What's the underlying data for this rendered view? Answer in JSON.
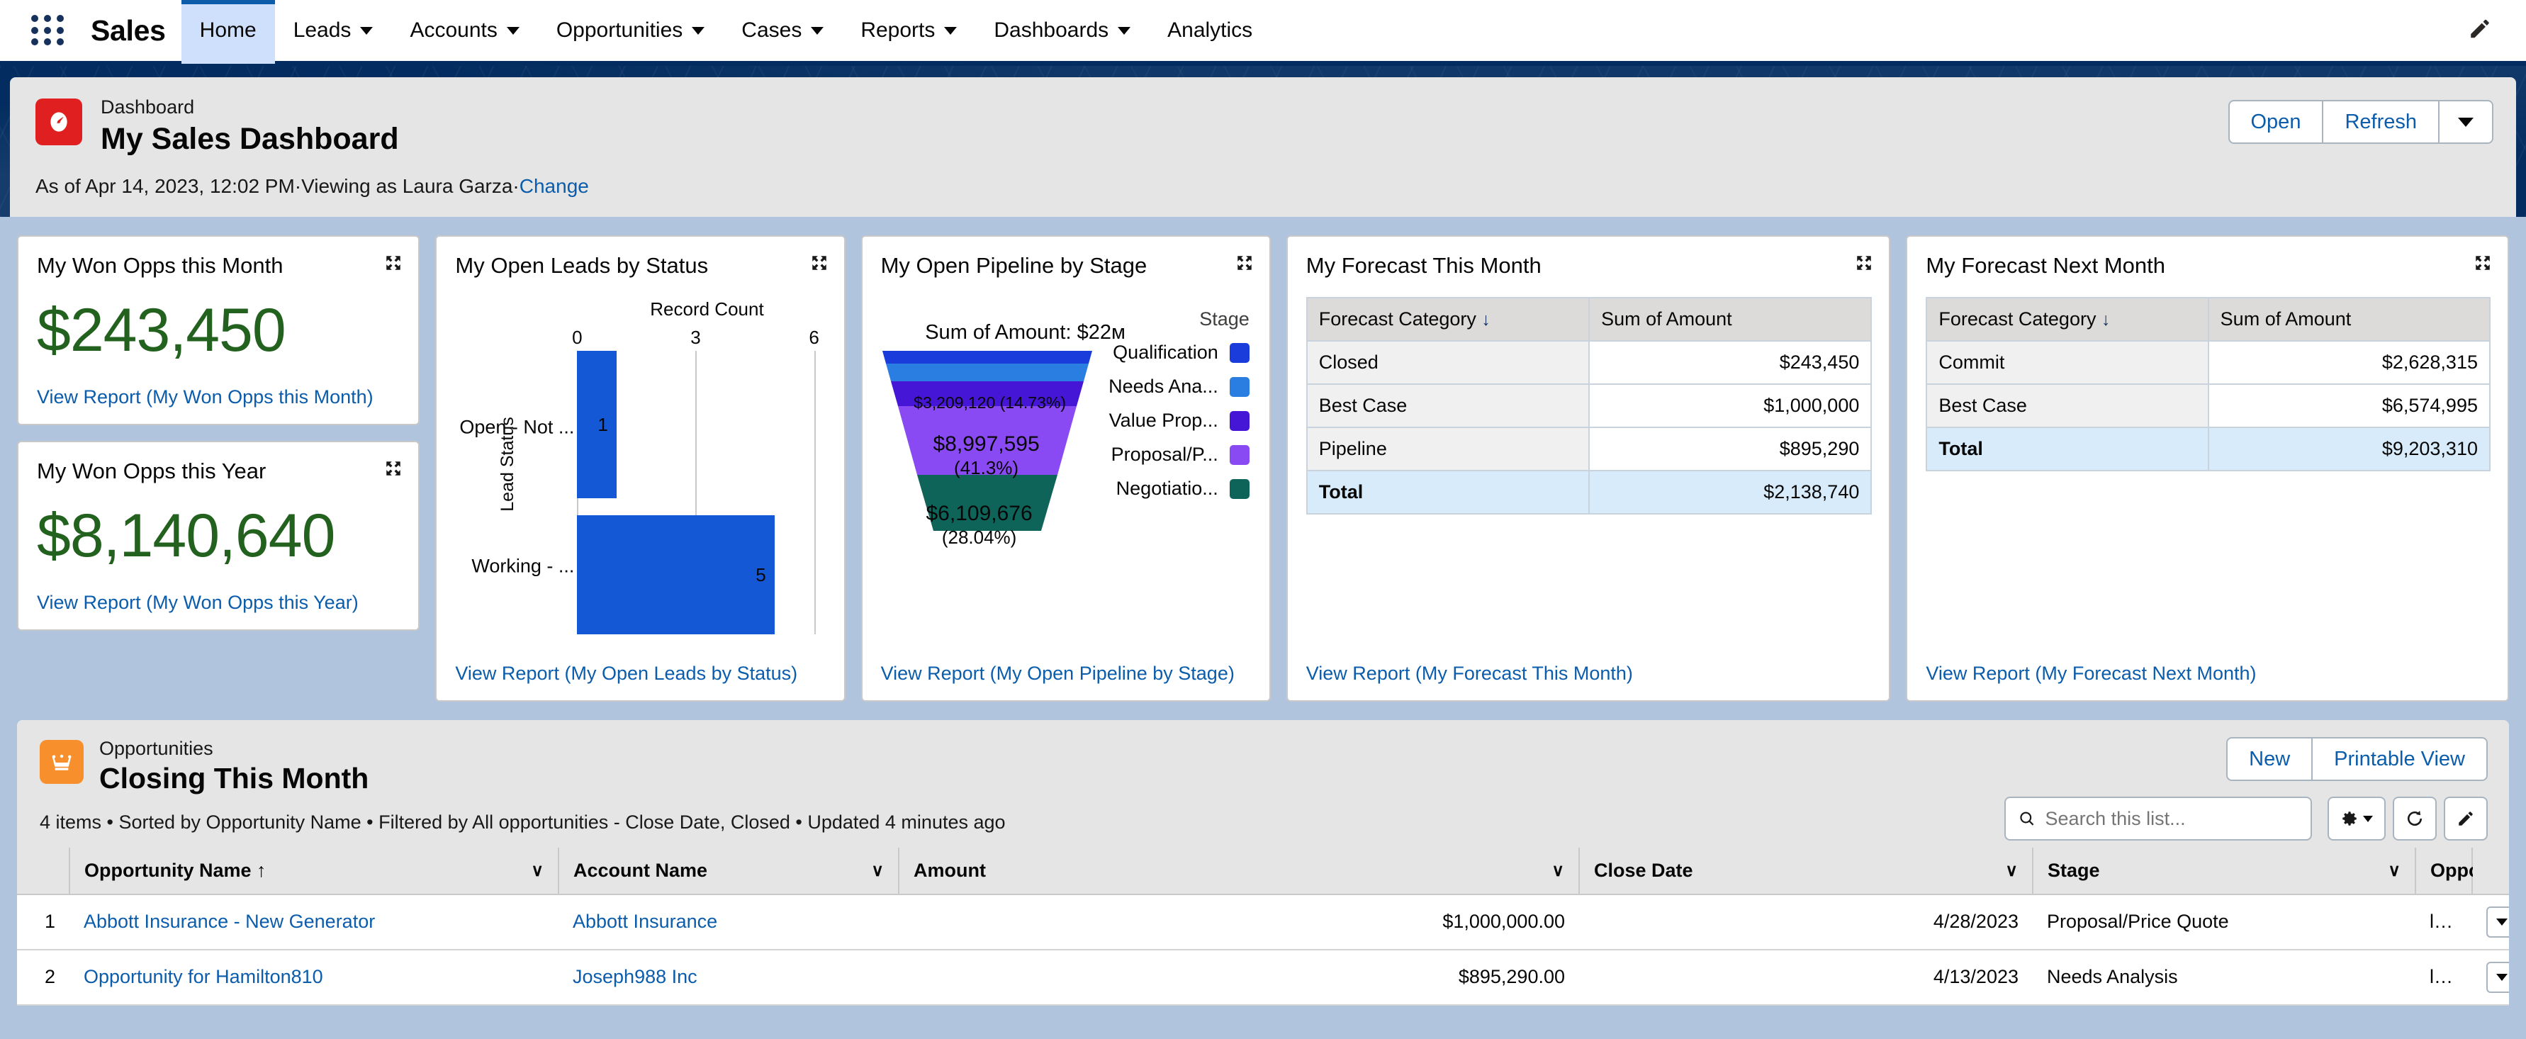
{
  "nav": {
    "app_name": "Sales",
    "items": [
      {
        "label": "Home",
        "has_caret": false,
        "active": true
      },
      {
        "label": "Leads",
        "has_caret": true,
        "active": false
      },
      {
        "label": "Accounts",
        "has_caret": true,
        "active": false
      },
      {
        "label": "Opportunities",
        "has_caret": true,
        "active": false
      },
      {
        "label": "Cases",
        "has_caret": true,
        "active": false
      },
      {
        "label": "Reports",
        "has_caret": true,
        "active": false
      },
      {
        "label": "Dashboards",
        "has_caret": true,
        "active": false
      },
      {
        "label": "Analytics",
        "has_caret": false,
        "active": false
      }
    ],
    "edit_icon": "pencil-icon"
  },
  "dashboard": {
    "eyebrow": "Dashboard",
    "title": "My Sales Dashboard",
    "subtitle_prefix": "As of Apr 14, 2023, 12:02 PM·Viewing as Laura Garza·",
    "change_link": "Change",
    "open_label": "Open",
    "refresh_label": "Refresh",
    "icon": "speedometer-icon",
    "icon_color": "#e02020"
  },
  "widgets": {
    "won_month": {
      "title": "My Won Opps this Month",
      "value": "$243,450",
      "link": "View Report (My Won Opps this Month)",
      "color": "#23611f"
    },
    "won_year": {
      "title": "My Won Opps this Year",
      "value": "$8,140,640",
      "link": "View Report (My Won Opps this Year)",
      "color": "#23611f"
    },
    "open_leads": {
      "title": "My Open Leads by Status",
      "link": "View Report (My Open Leads by Status)"
    },
    "pipeline": {
      "title": "My Open Pipeline by Stage",
      "link": "View Report (My Open Pipeline by Stage)"
    },
    "forecast_this": {
      "title": "My Forecast This Month",
      "link": "View Report (My Forecast This Month)"
    },
    "forecast_next": {
      "title": "My Forecast Next Month",
      "link": "View Report (My Forecast Next Month)"
    }
  },
  "chart_data": [
    {
      "type": "bar",
      "title": "My Open Leads by Status",
      "orientation": "horizontal",
      "categories": [
        "Open - Not ...",
        "Working - ..."
      ],
      "values": [
        1,
        5
      ],
      "xlabel": "Record Count",
      "ylabel": "Lead Status",
      "xlim": [
        0,
        6
      ],
      "xticks": [
        0,
        3,
        6
      ],
      "grid": true,
      "bar_color": "#1558d6",
      "data_labels": [
        "1",
        "5"
      ]
    },
    {
      "type": "funnel",
      "title": "My Open Pipeline by Stage",
      "annotation": "Sum of Amount: $22м",
      "legend_title": "Stage",
      "legend_position": "right",
      "slices": [
        {
          "name": "Qualification",
          "label": "",
          "pct_label": "",
          "value": 770000,
          "percent": 3.54,
          "color": "#1a3cdb"
        },
        {
          "name": "Needs Ana...",
          "label": "",
          "pct_label": "",
          "value": 2700000,
          "percent": 12.39,
          "color": "#2a7de1"
        },
        {
          "name": "Value Prop...",
          "label": "$3,209,120 (14.73%)",
          "pct_label": "",
          "value": 3209120,
          "percent": 14.73,
          "color": "#4616d6"
        },
        {
          "name": "Proposal/P...",
          "label": "$8,997,595",
          "pct_label": "(41.3%)",
          "value": 8997595,
          "percent": 41.3,
          "color": "#8a4af3"
        },
        {
          "name": "Negotiatio...",
          "label": "$6,109,676",
          "pct_label": "(28.04%)",
          "value": 6109676,
          "percent": 28.04,
          "color": "#0f6459"
        }
      ]
    },
    {
      "type": "table",
      "title": "My Forecast This Month",
      "columns": [
        "Forecast Category",
        "Sum of Amount"
      ],
      "rows": [
        [
          "Closed",
          "$243,450"
        ],
        [
          "Best Case",
          "$1,000,000"
        ],
        [
          "Pipeline",
          "$895,290"
        ]
      ],
      "total_row": [
        "Total",
        "$2,138,740"
      ]
    },
    {
      "type": "table",
      "title": "My Forecast Next Month",
      "columns": [
        "Forecast Category",
        "Sum of Amount"
      ],
      "rows": [
        [
          "Commit",
          "$2,628,315"
        ],
        [
          "Best Case",
          "$6,574,995"
        ]
      ],
      "total_row": [
        "Total",
        "$9,203,310"
      ]
    }
  ],
  "opportunities": {
    "eyebrow": "Opportunities",
    "title": "Closing This Month",
    "meta": "4 items • Sorted by Opportunity Name • Filtered by All opportunities - Close Date, Closed • Updated 4 minutes ago",
    "new_label": "New",
    "printable_label": "Printable View",
    "search_placeholder": "Search this list...",
    "columns": [
      "Opportunity Name ↑",
      "Account Name",
      "Amount",
      "Close Date",
      "Stage",
      "Opportunity Owner Alias"
    ],
    "rows": [
      {
        "num": "1",
        "name": "Abbott Insurance - New Generator",
        "account": "Abbott Insurance",
        "amount": "$1,000,000.00",
        "close_date": "4/28/2023",
        "stage": "Proposal/Price Quote",
        "owner": "lgarz"
      },
      {
        "num": "2",
        "name": "Opportunity for Hamilton810",
        "account": "Joseph988 Inc",
        "amount": "$895,290.00",
        "close_date": "4/13/2023",
        "stage": "Needs Analysis",
        "owner": "lgarz"
      }
    ]
  }
}
